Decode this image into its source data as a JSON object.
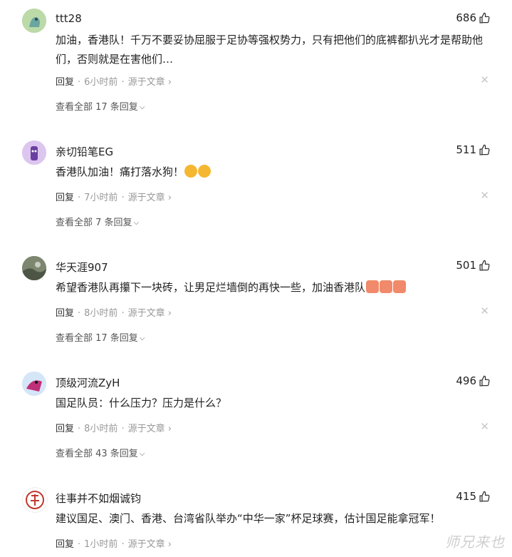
{
  "comments": [
    {
      "user": "ttt28",
      "likes": "686",
      "text": "加油，香港队！千万不要妥协屈服于足协等强权势力，只有把他们的底裤都扒光才是帮助他们，否则就是在害他们…",
      "reply_label": "回复",
      "time": "6小时前",
      "source": "源于文章",
      "more_replies": "查看全部 17 条回复"
    },
    {
      "user": "亲切铅笔EG",
      "likes": "511",
      "text": "香港队加油！痛打落水狗！",
      "reply_label": "回复",
      "time": "7小时前",
      "source": "源于文章",
      "more_replies": "查看全部 7 条回复"
    },
    {
      "user": "华天涯907",
      "likes": "501",
      "text": "希望香港队再攥下一块砖，让男足烂墙倒的再快一些，加油香港队",
      "reply_label": "回复",
      "time": "8小时前",
      "source": "源于文章",
      "more_replies": "查看全部 17 条回复"
    },
    {
      "user": "顶级河流ZyH",
      "likes": "496",
      "text": "国足队员：什么压力？压力是什么？",
      "reply_label": "回复",
      "time": "8小时前",
      "source": "源于文章",
      "more_replies": "查看全部 43 条回复"
    },
    {
      "user": "往事并不如烟诚钧",
      "likes": "415",
      "text": "建议国足、澳门、香港、台湾省队举办“中华一家”杯足球赛，估计国足能拿冠军！",
      "reply_label": "回复",
      "time": "1小时前",
      "source": "源于文章"
    }
  ],
  "watermark": "师兄来也",
  "colors": {
    "text": "#222222",
    "meta": "#999999",
    "close": "#c8c8c8",
    "background": "#ffffff"
  }
}
